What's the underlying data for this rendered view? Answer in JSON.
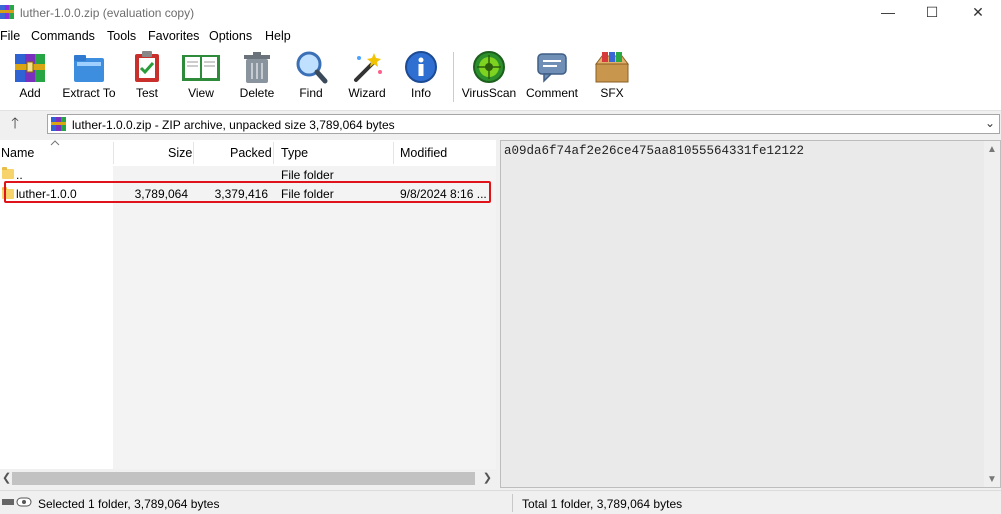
{
  "window": {
    "title": "luther-1.0.0.zip (evaluation copy)",
    "minimize_glyph": "—",
    "maximize_glyph": "☐",
    "close_glyph": "✕"
  },
  "menu": [
    "File",
    "Commands",
    "Tools",
    "Favorites",
    "Options",
    "Help"
  ],
  "toolbar": [
    {
      "label": "Add",
      "icon": "add-archive-icon"
    },
    {
      "label": "Extract To",
      "icon": "extract-folder-icon"
    },
    {
      "label": "Test",
      "icon": "test-clipboard-icon"
    },
    {
      "label": "View",
      "icon": "view-book-icon"
    },
    {
      "label": "Delete",
      "icon": "trash-can-icon"
    },
    {
      "label": "Find",
      "icon": "magnifier-icon"
    },
    {
      "label": "Wizard",
      "icon": "magic-wand-icon"
    },
    {
      "label": "Info",
      "icon": "info-icon"
    },
    {
      "label": "VirusScan",
      "icon": "virus-scan-icon"
    },
    {
      "label": "Comment",
      "icon": "comment-bubble-icon"
    },
    {
      "label": "SFX",
      "icon": "sfx-box-icon"
    }
  ],
  "address": {
    "text": "luther-1.0.0.zip - ZIP archive, unpacked size 3,789,064 bytes",
    "up_glyph": "🡑",
    "chevron": "⌄"
  },
  "columns": {
    "name": "Name",
    "size": "Size",
    "packed": "Packed",
    "type": "Type",
    "modified": "Modified"
  },
  "rows": [
    {
      "name": "..",
      "size": "",
      "packed": "",
      "type": "File folder",
      "modified": ""
    },
    {
      "name": "luther-1.0.0",
      "size": "3,789,064",
      "packed": "3,379,416",
      "type": "File folder",
      "modified": "9/8/2024 8:16 ..."
    }
  ],
  "comment": "a09da6f74af2e26ce475aa81055564331fe12122",
  "status": {
    "left": "Selected 1 folder, 3,789,064 bytes",
    "right": "Total 1 folder, 3,789,064 bytes"
  },
  "colors": {
    "selection_outline": "#e0131b",
    "folder": "#f7d36b"
  }
}
